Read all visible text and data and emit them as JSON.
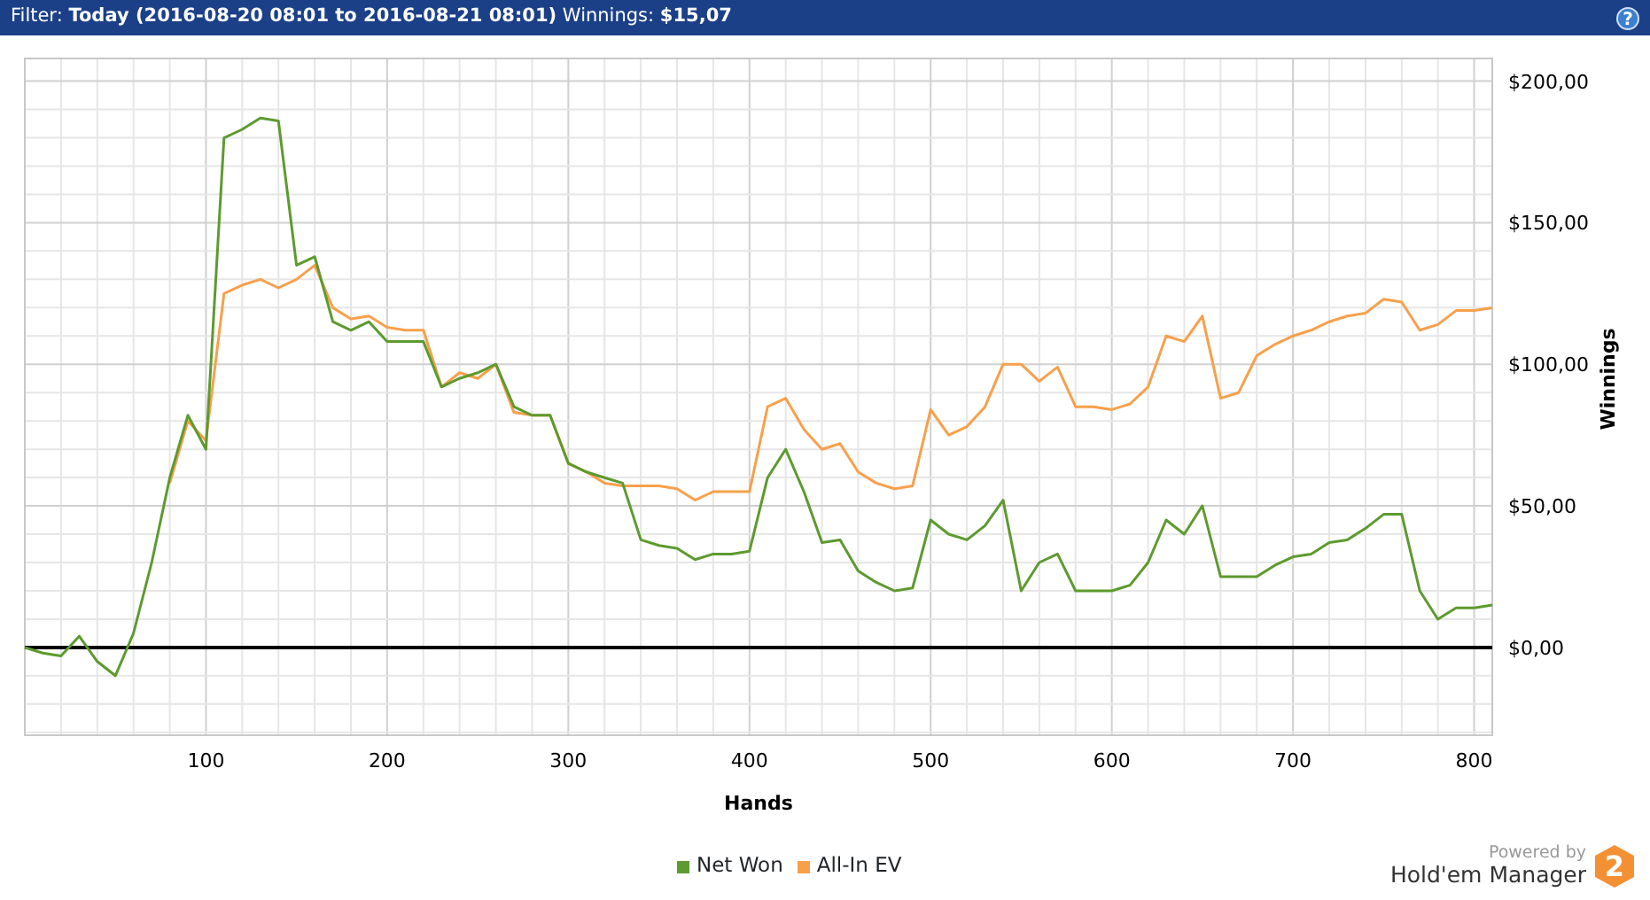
{
  "header": {
    "filter_text": "Filter: **Today (2016-08-20 08:01 to 2016-08-21 08:01)** Winnings: **$15,07**",
    "help_icon": "?"
  },
  "chart": {
    "chart_data": {
      "type": "line",
      "grid": true,
      "xlabel": "Hands",
      "ylabel": "Winnings",
      "xlim": [
        0,
        810
      ],
      "ylim": [
        -31,
        208
      ],
      "xticks": [
        100,
        200,
        300,
        400,
        500,
        600,
        700,
        800
      ],
      "yticks": [
        {
          "value": 0,
          "label": "$0,00"
        },
        {
          "value": 50,
          "label": "$50,00"
        },
        {
          "value": 100,
          "label": "$100,00"
        },
        {
          "value": 150,
          "label": "$150,00"
        },
        {
          "value": 200,
          "label": "$200,00"
        }
      ],
      "x": [
        0,
        10,
        20,
        30,
        40,
        50,
        60,
        70,
        80,
        90,
        100,
        110,
        120,
        130,
        140,
        150,
        160,
        170,
        180,
        190,
        200,
        210,
        220,
        230,
        240,
        250,
        260,
        270,
        280,
        290,
        300,
        310,
        320,
        330,
        340,
        350,
        360,
        370,
        380,
        390,
        400,
        410,
        420,
        430,
        440,
        450,
        460,
        470,
        480,
        490,
        500,
        510,
        520,
        530,
        540,
        550,
        560,
        570,
        580,
        590,
        600,
        610,
        620,
        630,
        640,
        650,
        660,
        670,
        680,
        690,
        700,
        710,
        720,
        730,
        740,
        750,
        760,
        770,
        780,
        790,
        800,
        810
      ],
      "series": [
        {
          "name": "Net Won",
          "color": "#5d9a2f",
          "values": [
            0,
            -2,
            -3,
            4,
            -5,
            -10,
            5,
            30,
            60,
            82,
            70,
            180,
            183,
            187,
            186,
            135,
            138,
            115,
            112,
            115,
            108,
            108,
            108,
            92,
            95,
            97,
            100,
            85,
            82,
            82,
            65,
            62,
            60,
            58,
            38,
            36,
            35,
            31,
            33,
            33,
            34,
            60,
            70,
            55,
            37,
            38,
            27,
            23,
            20,
            21,
            45,
            40,
            38,
            43,
            52,
            20,
            30,
            33,
            20,
            20,
            20,
            22,
            30,
            45,
            40,
            50,
            25,
            25,
            25,
            29,
            32,
            33,
            37,
            38,
            42,
            47,
            47,
            20,
            10,
            14,
            14,
            15
          ]
        },
        {
          "name": "All-In EV",
          "color": "#f7a04b",
          "values": [
            null,
            null,
            null,
            null,
            null,
            null,
            null,
            null,
            58,
            80,
            73,
            125,
            128,
            130,
            127,
            130,
            135,
            120,
            116,
            117,
            113,
            112,
            112,
            92,
            97,
            95,
            100,
            83,
            82,
            82,
            65,
            62,
            58,
            57,
            57,
            57,
            56,
            52,
            55,
            55,
            55,
            85,
            88,
            77,
            70,
            72,
            62,
            58,
            56,
            57,
            84,
            75,
            78,
            85,
            100,
            100,
            94,
            99,
            85,
            85,
            84,
            86,
            92,
            110,
            108,
            117,
            88,
            90,
            103,
            107,
            110,
            112,
            115,
            117,
            118,
            123,
            122,
            112,
            114,
            119,
            119,
            120
          ]
        }
      ]
    }
  },
  "branding": {
    "powered_by": "Powered by",
    "product": "Hold'em Manager",
    "badge": "2"
  }
}
